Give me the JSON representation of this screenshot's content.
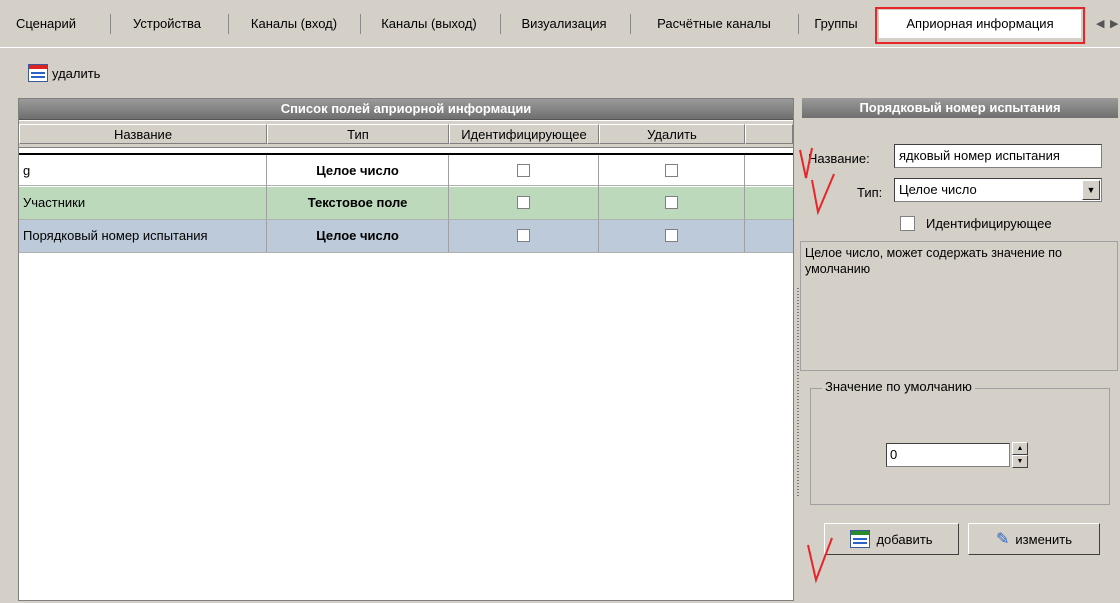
{
  "tabs": [
    {
      "label": "Сценарий"
    },
    {
      "label": "Устройства"
    },
    {
      "label": "Каналы (вход)"
    },
    {
      "label": "Каналы (выход)"
    },
    {
      "label": "Визуализация"
    },
    {
      "label": "Расчётные каналы"
    },
    {
      "label": "Группы"
    },
    {
      "label": "Априорная информация"
    }
  ],
  "toolbar": {
    "delete_label": "удалить"
  },
  "list_panel": {
    "title": "Список полей априорной информации",
    "columns": [
      "Название",
      "Тип",
      "Идентифицирующее",
      "Удалить"
    ],
    "rows": [
      {
        "name": "g",
        "type": "Целое число",
        "identifying": false,
        "delete": false,
        "color": "#ffffff"
      },
      {
        "name": "Участники",
        "type": "Текстовое поле",
        "identifying": false,
        "delete": false,
        "color": "#bcd9bc"
      },
      {
        "name": "Порядковый номер испытания",
        "type": "Целое число",
        "identifying": false,
        "delete": false,
        "color": "#bccad9"
      }
    ]
  },
  "detail_panel": {
    "title": "Порядковый номер испытания",
    "name_label": "Название:",
    "name_value": "ядковый номер испытания",
    "type_label": "Тип:",
    "type_value": "Целое число",
    "identifying_label": "Идентифицирующее",
    "description": "Целое число, может содержать значение по умолчанию",
    "default_group_label": "Значение по умолчанию",
    "default_value": "0",
    "add_label": "добавить",
    "edit_label": "изменить"
  },
  "colors": {
    "highlight": "#e8262a",
    "title_bar": "#7a7a7a"
  }
}
